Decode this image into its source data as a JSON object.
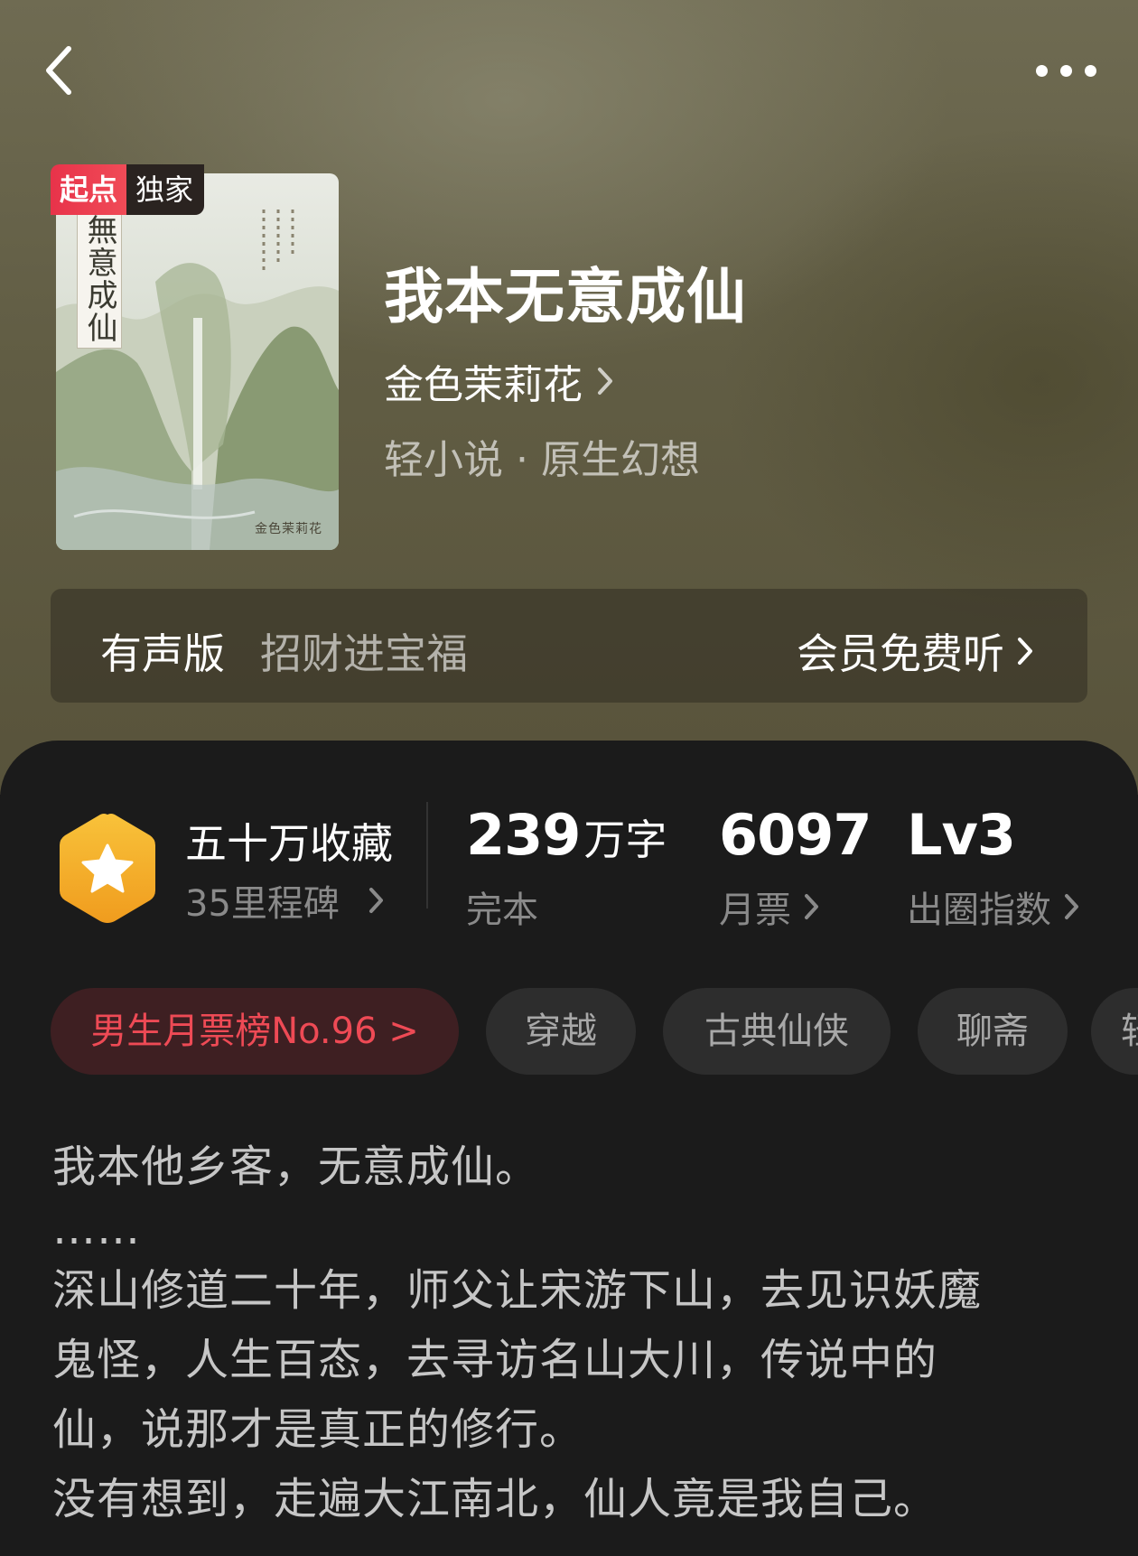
{
  "header": {
    "back_icon": "chevron-left-icon",
    "more_icon": "more-horizontal-icon"
  },
  "cover": {
    "badge_brand": "起点",
    "badge_exclusive": "独家",
    "cover_title": "無意成仙",
    "cover_author": "金色茉莉花"
  },
  "book": {
    "title": "我本无意成仙",
    "author": "金色茉莉花",
    "genre": "轻小说 · 原生幻想"
  },
  "audio": {
    "label": "有声版",
    "title": "招财进宝福",
    "cta": "会员免费听"
  },
  "stats": {
    "favorites": "五十万收藏",
    "milestones": "35里程碑",
    "words_number": "239",
    "words_unit": "万字",
    "status": "完本",
    "monthly_tickets": "6097",
    "monthly_tickets_label": "月票",
    "level": "Lv3",
    "level_label": "出圈指数"
  },
  "tags": {
    "rank": "男生月票榜No.96 >",
    "items": [
      "穿越",
      "古典仙侠",
      "聊斋",
      "轻"
    ]
  },
  "synopsis": {
    "lines": [
      "我本他乡客，无意成仙。",
      "……",
      "深山修道二十年，师父让宋游下山，去见识妖魔",
      "鬼怪，人生百态，去寻访名山大川，传说中的",
      "仙，说那才是真正的修行。",
      "没有想到，走遍大江南北，仙人竟是我自己。"
    ]
  },
  "colors": {
    "accent_red": "#ee4a55",
    "hexagon_gold": "#f5b12a",
    "sheet_bg": "#1b1b1b"
  }
}
